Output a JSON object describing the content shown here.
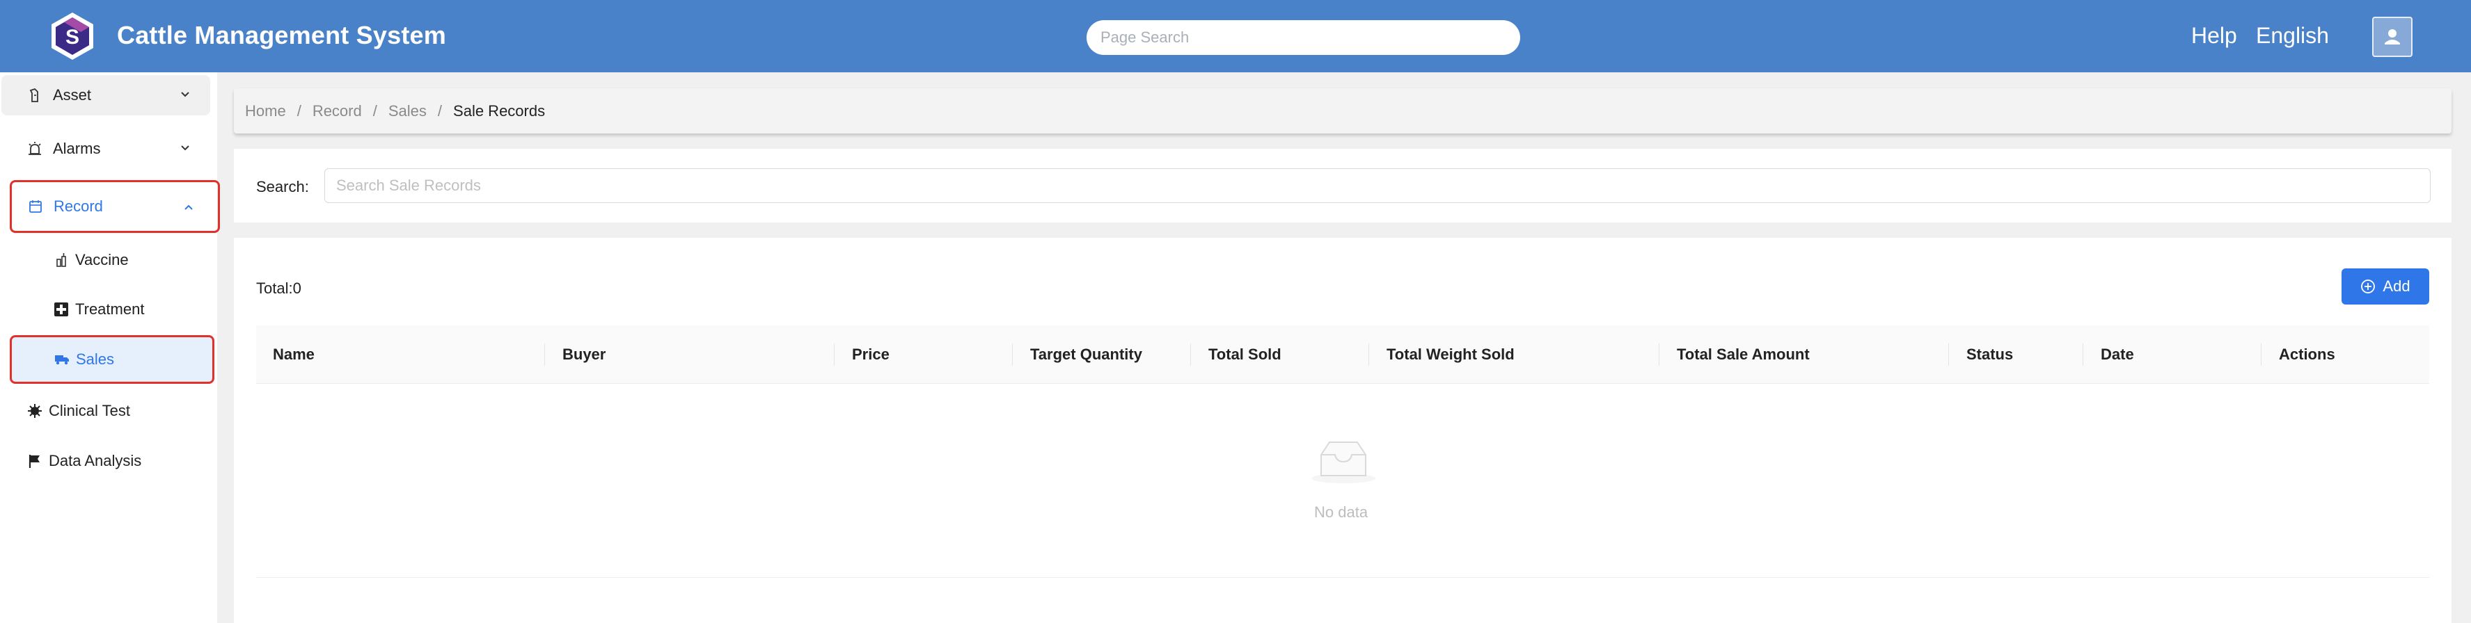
{
  "header": {
    "title": "Cattle Management System",
    "search_placeholder": "Page Search",
    "help": "Help",
    "language": "English",
    "icons": {
      "logo": "logo-icon",
      "user": "user-icon"
    },
    "background_color": "#4a82c9"
  },
  "sidebar": {
    "items": [
      {
        "label": "Asset",
        "icon": "asset-icon",
        "expanded": false
      },
      {
        "label": "Alarms",
        "icon": "alarm-icon",
        "expanded": false
      },
      {
        "label": "Record",
        "icon": "record-icon",
        "expanded": true,
        "active": true,
        "children": [
          {
            "label": "Vaccine",
            "icon": "vaccine-icon"
          },
          {
            "label": "Treatment",
            "icon": "treatment-icon"
          },
          {
            "label": "Sales",
            "icon": "sales-icon",
            "active": true
          }
        ]
      },
      {
        "label": "Clinical Test",
        "icon": "clinical-icon"
      },
      {
        "label": "Data Analysis",
        "icon": "flag-icon"
      }
    ],
    "active_color": "#2f77e8",
    "highlight_border_color": "#e0322b"
  },
  "breadcrumb": [
    "Home",
    "Record",
    "Sales",
    "Sale Records"
  ],
  "search": {
    "label": "Search:",
    "placeholder": "Search Sale Records"
  },
  "table": {
    "total_label": "Total:0",
    "add_label": "Add",
    "columns": [
      "Name",
      "Buyer",
      "Price",
      "Target Quantity",
      "Total Sold",
      "Total Weight Sold",
      "Total Sale Amount",
      "Status",
      "Date",
      "Actions"
    ],
    "rows": [],
    "empty_text": "No data"
  }
}
